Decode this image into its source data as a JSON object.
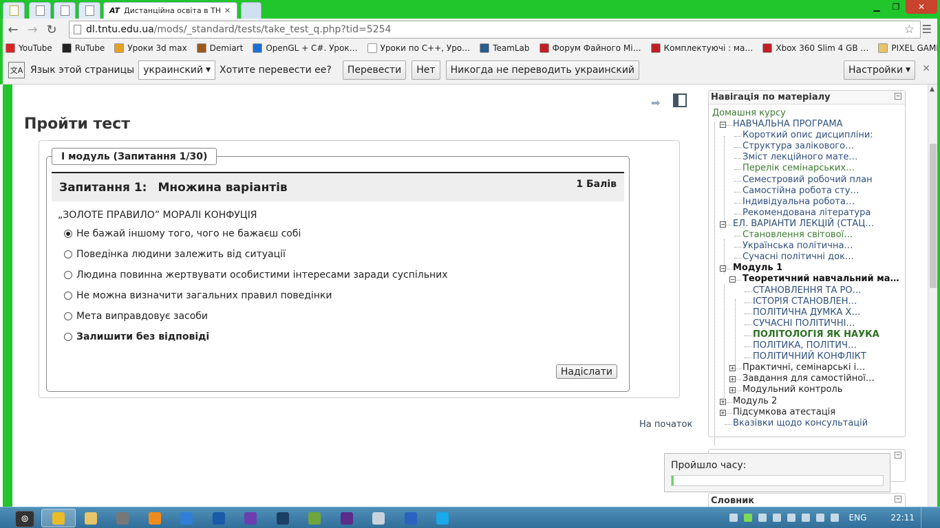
{
  "browser": {
    "active_tab": {
      "logo": "AT",
      "title": "Дистанційна освіта в ТНТ",
      "close": "✕"
    },
    "window_buttons": {
      "minimize": "▁",
      "maximize": "❐",
      "close": "✕"
    },
    "url_host": "dl.tntu.edu.ua",
    "url_path": "/mods/_standard/tests/take_test_q.php?tid=5254",
    "bookmarks": [
      {
        "label": "YouTube",
        "color": "#d92424"
      },
      {
        "label": "RuTube",
        "color": "#222222"
      },
      {
        "label": "Уроки 3d max",
        "color": "#e8a020"
      },
      {
        "label": "Demiart",
        "color": "#9a5a1a"
      },
      {
        "label": "OpenGL + C#. Урок…",
        "color": "#1e6fd0"
      },
      {
        "label": "Уроки по C++, Уро…",
        "color": "#ffffff"
      },
      {
        "label": "TeamLab",
        "color": "#2a5c8c"
      },
      {
        "label": "Форум Файного Мі…",
        "color": "#c02020"
      },
      {
        "label": "Комплектуючі : ма…",
        "color": "#c02020"
      },
      {
        "label": "Xbox 360 Slim 4 GB …",
        "color": "#c02020"
      },
      {
        "label": "PIXEL GAMES",
        "color": "#e7c36a"
      }
    ]
  },
  "translate_bar": {
    "prompt": "Язык этой страницы",
    "language": "украинский",
    "question": "Хотите перевести ее?",
    "translate": "Перевести",
    "no": "Нет",
    "never": "Никогда не переводить украинский",
    "settings": "Настройки",
    "close": "✕"
  },
  "page": {
    "title": "Пройти тест",
    "legend": "І модуль (Запитання 1/30)",
    "question_number": "Запитання 1:",
    "question_type": "Множина варіантів",
    "score": "1 Балів",
    "question_text": "„ЗОЛОТЕ ПРАВИЛО” МОРАЛІ КОНФУЦІЯ",
    "answers": [
      {
        "label": "Не бажай іншому того, чого не бажаєш собі",
        "selected": true
      },
      {
        "label": "Поведінка людини залежить від ситуації",
        "selected": false
      },
      {
        "label": "Людина повинна жертвувати особистими інтересами заради суспільних",
        "selected": false
      },
      {
        "label": "Не можна визначити загальних правил поведінки",
        "selected": false
      },
      {
        "label": "Мета виправдовує засоби",
        "selected": false
      },
      {
        "label": "Залишити без відповіді",
        "selected": false
      }
    ],
    "submit": "Надіслати",
    "to_top": "На початок"
  },
  "sidebar": {
    "nav_title": "Навігація по матеріалу",
    "home": "Домашня курсу",
    "tree": [
      {
        "label": "НАВЧАЛЬНА ПРОГРАМА",
        "level": 1,
        "style": "link",
        "expander": "minus"
      },
      {
        "label": "Короткий опис дисципліни:",
        "level": 2,
        "style": "link"
      },
      {
        "label": "Структура залікового…",
        "level": 2,
        "style": "link"
      },
      {
        "label": "Зміст лекційного мате…",
        "level": 2,
        "style": "link"
      },
      {
        "label": "Перелік семінарських…",
        "level": 2,
        "style": "green"
      },
      {
        "label": "Семестровий робочий план",
        "level": 2,
        "style": "link"
      },
      {
        "label": "Самостійна робота сту…",
        "level": 2,
        "style": "link"
      },
      {
        "label": "Індивідуальна робота…",
        "level": 2,
        "style": "link"
      },
      {
        "label": "Рекомендована література",
        "level": 2,
        "style": "link"
      },
      {
        "label": "ЕЛ. ВАРІАНТИ ЛЕКЦІЙ (СТАЦ…",
        "level": 1,
        "style": "link",
        "expander": "minus"
      },
      {
        "label": "Становлення світової…",
        "level": 2,
        "style": "green"
      },
      {
        "label": "Українська політична…",
        "level": 2,
        "style": "link"
      },
      {
        "label": "Сучасні політичні док…",
        "level": 2,
        "style": "link"
      },
      {
        "label": "Модуль 1",
        "level": 1,
        "style": "bold",
        "expander": "minus"
      },
      {
        "label": "Теоретичний навчальний ма…",
        "level": 2,
        "style": "bold",
        "expander": "minus"
      },
      {
        "label": "СТАНОВЛЕННЯ ТА РО…",
        "level": 3,
        "style": "link"
      },
      {
        "label": "ІСТОРІЯ СТАНОВЛЕН…",
        "level": 3,
        "style": "link"
      },
      {
        "label": "ПОЛІТИЧНА ДУМКА Х…",
        "level": 3,
        "style": "link"
      },
      {
        "label": "СУЧАСНІ ПОЛІТИЧНІ…",
        "level": 3,
        "style": "link"
      },
      {
        "label": "ПОЛІТОЛОГІЯ ЯК НАУКА",
        "level": 3,
        "style": "current"
      },
      {
        "label": "ПОЛІТИКА, ПОЛІТИЧ…",
        "level": 3,
        "style": "link"
      },
      {
        "label": "ПОЛІТИЧНИЙ КОНФЛІКТ",
        "level": 3,
        "style": "link"
      },
      {
        "label": "Практичні, семінарські і…",
        "level": 2,
        "style": "plain",
        "expander": "plus"
      },
      {
        "label": "Завдання для самостійної…",
        "level": 2,
        "style": "plain",
        "expander": "plus"
      },
      {
        "label": "Модульний контроль",
        "level": 2,
        "style": "plain",
        "expander": "plus"
      },
      {
        "label": "Модуль 2",
        "level": 1,
        "style": "plain",
        "expander": "plus"
      },
      {
        "label": "Підсумкова атестація",
        "level": 1,
        "style": "plain",
        "expander": "plus"
      },
      {
        "label": "Вказівки щодо консультацій",
        "level": 1,
        "style": "link"
      }
    ],
    "time_label": "Пройшло часу:",
    "time_progress": 0.01,
    "dictionary_title": "Словник"
  },
  "taskbar": {
    "language": "ENG",
    "clock": "22:11",
    "apps": [
      {
        "name": "chrome",
        "color": "#e9bb2a",
        "active": true
      },
      {
        "name": "explorer",
        "color": "#e7c36a",
        "active": false
      },
      {
        "name": "video-editor",
        "color": "#777777",
        "active": false
      },
      {
        "name": "media-player",
        "color": "#f08a1c",
        "active": false
      },
      {
        "name": "flash",
        "color": "#2f7fd8",
        "active": false
      },
      {
        "name": "network",
        "color": "#1a5aa8",
        "active": false
      },
      {
        "name": "visual-studio",
        "color": "#6a3fb0",
        "active": false
      },
      {
        "name": "photoshop",
        "color": "#1c3f66",
        "active": false
      },
      {
        "name": "excel-tool",
        "color": "#6ea63c",
        "active": false
      },
      {
        "name": "vs-ide",
        "color": "#5b2c8a",
        "active": false
      },
      {
        "name": "calculator",
        "color": "#c8d3de",
        "active": false
      },
      {
        "name": "word",
        "color": "#2a62c0",
        "active": false
      },
      {
        "name": "skype",
        "color": "#19a9e8",
        "active": false
      }
    ]
  }
}
